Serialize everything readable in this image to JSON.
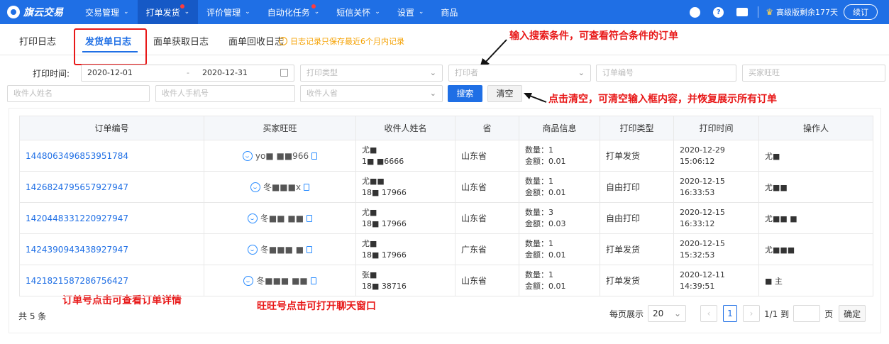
{
  "app": {
    "name": "旗云交易"
  },
  "nav": [
    {
      "label": "交易管理",
      "chev": "⌄",
      "active": false,
      "dot": false
    },
    {
      "label": "打单发货",
      "chev": "⌄",
      "active": true,
      "dot": true
    },
    {
      "label": "评价管理",
      "chev": "⌄",
      "active": false,
      "dot": false
    },
    {
      "label": "自动化任务",
      "chev": "⌄",
      "active": false,
      "dot": true
    },
    {
      "label": "短信关怀",
      "chev": "⌄",
      "active": false,
      "dot": false
    },
    {
      "label": "设置",
      "chev": "⌄",
      "active": false,
      "dot": false
    },
    {
      "label": "商品",
      "chev": "",
      "active": false,
      "dot": false
    }
  ],
  "topright": {
    "help": "?",
    "version": "高级版剩余177天",
    "renew": "续订"
  },
  "tabs": [
    {
      "label": "打印日志"
    },
    {
      "label": "发货单日志"
    },
    {
      "label": "面单获取日志"
    },
    {
      "label": "面单回收日志"
    }
  ],
  "notice": "日志记录只保存最近6个月内记录",
  "annotations": {
    "search_hint": "输入搜索条件，可查看符合条件的订单",
    "clear_hint": "点击清空，可清空输入框内容，并恢复展示所有订单",
    "order_hint": "订单号点击可查看订单详情",
    "wangwang_hint": "旺旺号点击可打开聊天窗口"
  },
  "filters": {
    "print_time_label": "打印时间:",
    "date_start": "2020-12-01",
    "date_sep": "-",
    "date_end": "2020-12-31",
    "print_type_placeholder": "打印类型",
    "printer_placeholder": "打印者",
    "order_no_placeholder": "订单编号",
    "buyer_placeholder": "买家旺旺",
    "receiver_name_placeholder": "收件人姓名",
    "receiver_phone_placeholder": "收件人手机号",
    "receiver_province_placeholder": "收件人省",
    "search_button": "搜索",
    "clear_button": "清空"
  },
  "table": {
    "headers": [
      "订单编号",
      "买家旺旺",
      "收件人姓名",
      "省",
      "商品信息",
      "打印类型",
      "打印时间",
      "操作人"
    ],
    "rows": [
      {
        "order": "1448063496853951784",
        "buyer": "yo■ ■■966",
        "name": "尤■",
        "phone": "1■ ■6666",
        "province": "山东省",
        "qty": "数量：1",
        "amount": "金额：0.01",
        "type": "打单发货",
        "date": "2020-12-29",
        "time": "15:06:12",
        "operator": "尤■"
      },
      {
        "order": "1426824795657927947",
        "buyer": "冬■■■x",
        "name": "尤■■",
        "phone": "18■ 17966",
        "province": "山东省",
        "qty": "数量：1",
        "amount": "金额：0.01",
        "type": "自由打印",
        "date": "2020-12-15",
        "time": "16:33:53",
        "operator": "尤■■"
      },
      {
        "order": "1420448331220927947",
        "buyer": "冬■■ ■■",
        "name": "尤■",
        "phone": "18■ 17966",
        "province": "山东省",
        "qty": "数量：3",
        "amount": "金额：0.03",
        "type": "自由打印",
        "date": "2020-12-15",
        "time": "16:33:12",
        "operator": "尤■■ ■"
      },
      {
        "order": "1424390943438927947",
        "buyer": "冬■■■ ■",
        "name": "尤■",
        "phone": "18■ 17966",
        "province": "广东省",
        "qty": "数量：1",
        "amount": "金额：0.01",
        "type": "打单发货",
        "date": "2020-12-15",
        "time": "15:32:53",
        "operator": "尤■■■"
      },
      {
        "order": "1421821587286756427",
        "buyer": "冬■■■ ■■",
        "name": "张■",
        "phone": "18■ 38716",
        "province": "山东省",
        "qty": "数量：1",
        "amount": "金额：0.01",
        "type": "打单发货",
        "date": "2020-12-11",
        "time": "14:39:51",
        "operator": "■ 主"
      }
    ]
  },
  "footer": {
    "total": "共 5 条",
    "per_page_label": "每页展示",
    "per_page_value": "20",
    "current_page": "1",
    "page_count": "1/1 到",
    "page_suffix": "页",
    "confirm": "确定"
  },
  "colors": {
    "primary": "#1f6fe5",
    "annotation": "#e81818",
    "notice": "#f5a100"
  },
  "icons": [
    "logo-icon",
    "chevron-down-icon",
    "notification-icon",
    "help-icon",
    "message-icon",
    "crown-icon",
    "calendar-icon",
    "arrow-icon",
    "wangwang-icon",
    "copy-icon",
    "chevron-left-icon",
    "chevron-right-icon",
    "info-icon"
  ]
}
